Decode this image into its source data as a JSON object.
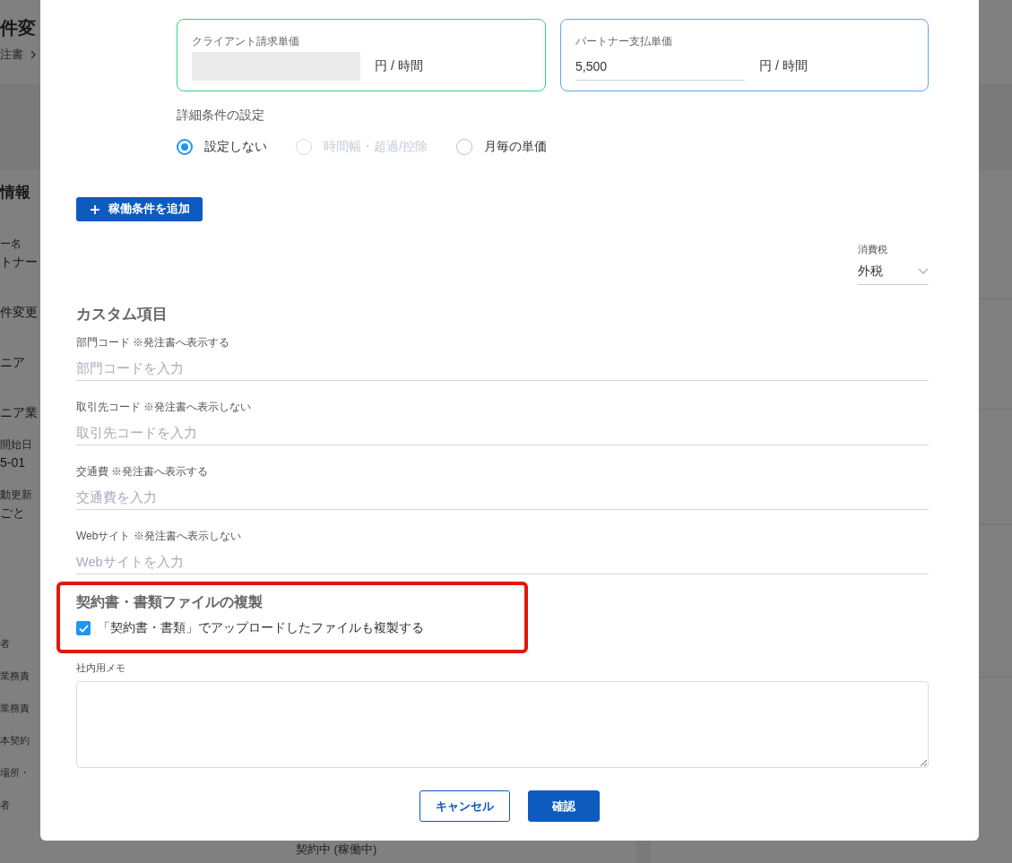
{
  "background_page": {
    "title": "件変",
    "breadcrumb": "注書",
    "section_title": "情報",
    "rows": [
      {
        "label": "ー名",
        "value": "トナー"
      },
      {
        "value": "件変更"
      },
      {
        "value": "ニア"
      },
      {
        "value": "ニア業"
      },
      {
        "label": "開始日",
        "value": "5-01"
      },
      {
        "label": "動更新",
        "value": "ごと"
      }
    ],
    "labels": [
      "者",
      "業務責",
      "業務責",
      "本契約",
      "場所・",
      "者"
    ],
    "status": "契約中 (稼働中)"
  },
  "price_cards": [
    {
      "kind": "masked",
      "label": "クライアント請求単価",
      "unit": "円 / 時間",
      "color": "#3ad37e"
    },
    {
      "kind": "input",
      "label": "パートナー支払単価",
      "value": "5,500",
      "unit": "円 / 時間",
      "color": "#5ea5f3"
    }
  ],
  "detail_settings": {
    "label": "詳細条件の設定",
    "options": [
      {
        "label": "設定しない",
        "selected": true,
        "disabled": false
      },
      {
        "label": "時間幅・超過/控除",
        "selected": false,
        "disabled": true
      },
      {
        "label": "月毎の単価",
        "selected": false,
        "disabled": false
      }
    ]
  },
  "add_condition_button": {
    "label": "稼働条件を追加"
  },
  "tax": {
    "label": "消費税",
    "value": "外税"
  },
  "custom_fields": {
    "title": "カスタム項目",
    "fields": [
      {
        "label": "部門コード ※発注書へ表示する",
        "placeholder": "部門コードを入力"
      },
      {
        "label": "取引先コード ※発注書へ表示しない",
        "placeholder": "取引先コードを入力"
      },
      {
        "label": "交通費 ※発注書へ表示する",
        "placeholder": "交通費を入力"
      },
      {
        "label": "Webサイト ※発注書へ表示しない",
        "placeholder": "Webサイトを入力"
      }
    ]
  },
  "file_copy": {
    "title": "契約書・書類ファイルの複製",
    "highlighted": true,
    "checkbox": {
      "label": "「契約書・書類」でアップロードしたファイルも複製する",
      "checked": true
    }
  },
  "memo": {
    "label": "社内用メモ"
  },
  "buttons": [
    {
      "kind": "secondary",
      "label": "キャンセル"
    },
    {
      "kind": "primary",
      "label": "確認"
    }
  ]
}
